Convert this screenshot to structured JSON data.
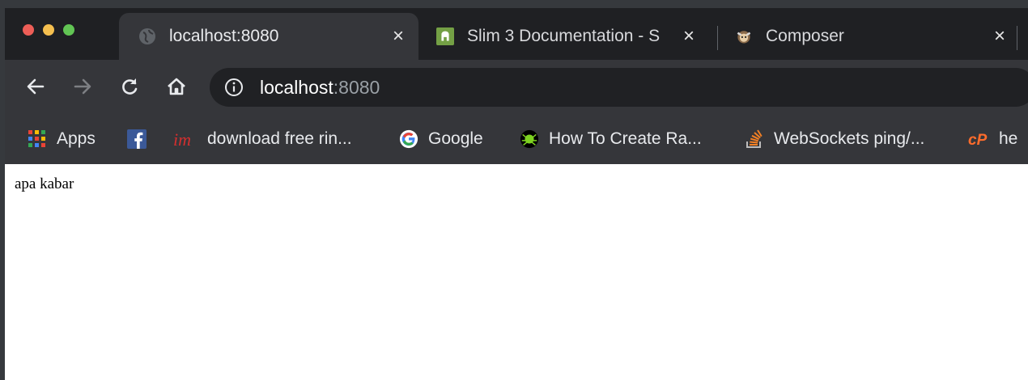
{
  "tabs": [
    {
      "title": "localhost:8080",
      "favicon": "globe-icon",
      "close": "×"
    },
    {
      "title": "Slim 3 Documentation - S",
      "favicon": "slim-icon",
      "close": "×"
    },
    {
      "title": "Composer",
      "favicon": "composer-icon",
      "close": "×"
    }
  ],
  "toolbar": {
    "url_host": "localhost",
    "url_port": ":8080"
  },
  "bookmarks": [
    {
      "label": "Apps",
      "icon": "apps-grid-icon"
    },
    {
      "label": "",
      "icon": "facebook-icon"
    },
    {
      "label": "download free rin...",
      "icon": "im-icon"
    },
    {
      "label": "Google",
      "icon": "google-icon"
    },
    {
      "label": "How To Create Ra...",
      "icon": "spider-icon"
    },
    {
      "label": "WebSockets ping/...",
      "icon": "stackoverflow-icon"
    },
    {
      "label": "he",
      "icon": "cpanel-icon"
    }
  ],
  "page": {
    "body_text": "apa kabar"
  },
  "colors": {
    "chrome_dark": "#1f2023",
    "chrome_tab": "#35363a",
    "omnibox": "#202124",
    "traffic_red": "#ed5e57",
    "traffic_yellow": "#f5bf4f",
    "traffic_green": "#62c554"
  }
}
